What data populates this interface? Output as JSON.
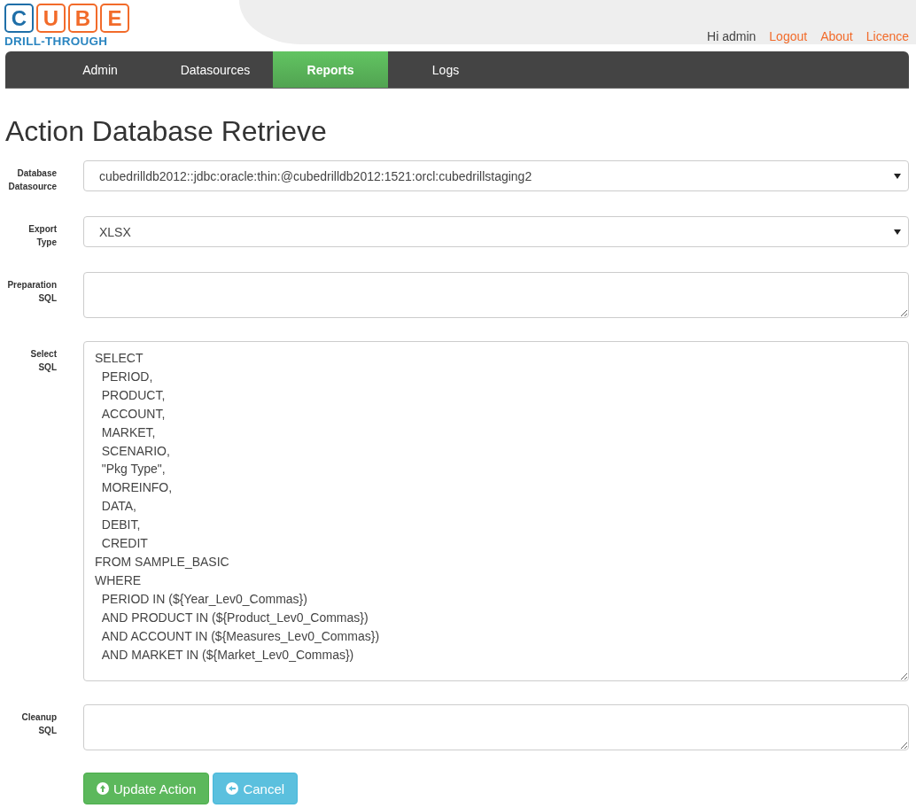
{
  "logo": {
    "letters": [
      {
        "char": "C",
        "color": "#1f6fa8"
      },
      {
        "char": "U",
        "color": "#f26b2a"
      },
      {
        "char": "B",
        "color": "#f26b2a"
      },
      {
        "char": "E",
        "color": "#f26b2a"
      }
    ],
    "tagline": "DRILL-THROUGH"
  },
  "user_bar": {
    "greeting": "Hi admin",
    "links": [
      "Logout",
      "About",
      "Licence"
    ]
  },
  "nav": [
    {
      "label": "Admin",
      "selected": false
    },
    {
      "label": "Datasources",
      "selected": false
    },
    {
      "label": "Reports",
      "selected": true
    },
    {
      "label": "Logs",
      "selected": false
    }
  ],
  "title": "Action Database Retrieve",
  "fields": [
    {
      "kind": "select",
      "label": [
        "Database",
        "Datasource"
      ],
      "value": "cubedrilldb2012::jdbc:oracle:thin:@cubedrilldb2012:1521:orcl:cubedrillstaging2"
    },
    {
      "kind": "select",
      "label": [
        "Export",
        "Type"
      ],
      "value": "XLSX"
    },
    {
      "kind": "textarea",
      "label": [
        "Preparation",
        "SQL"
      ]
    },
    {
      "kind": "textarea",
      "label": [
        "Select",
        "SQL"
      ],
      "value": "SELECT\n  PERIOD,\n  PRODUCT,\n  ACCOUNT,\n  MARKET,\n  SCENARIO,\n  \"Pkg Type\",\n  MOREINFO,\n  DATA,\n  DEBIT,\n  CREDIT\nFROM SAMPLE_BASIC\nWHERE\n  PERIOD IN (${Year_Lev0_Commas})\n  AND PRODUCT IN (${Product_Lev0_Commas})\n  AND ACCOUNT IN (${Measures_Lev0_Commas})\n  AND MARKET IN (${Market_Lev0_Commas})"
    },
    {
      "kind": "textarea",
      "label": [
        "Cleanup",
        "SQL"
      ]
    }
  ],
  "buttons": [
    {
      "kind": "primary",
      "label": "Update Action"
    },
    {
      "kind": "cancel",
      "label": "Cancel"
    }
  ]
}
